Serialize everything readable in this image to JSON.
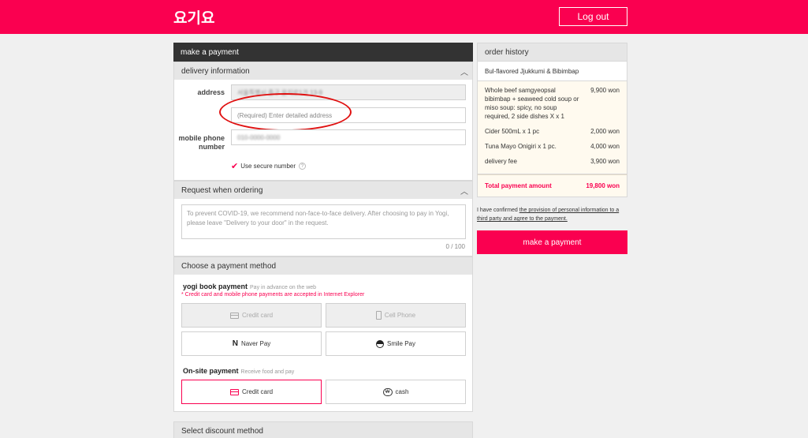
{
  "header": {
    "logo": "요기요",
    "logout_label": "Log out"
  },
  "payment": {
    "title": "make a payment",
    "delivery": {
      "heading": "delivery information",
      "address_label": "address",
      "address_value": "서울특별시 중구 을지로1가 13-9",
      "detail_placeholder": "(Required) Enter detailed address",
      "phone_label": "mobile phone number",
      "phone_value": "010-0000-0000",
      "secure_label": "Use secure number",
      "secure_help": "?"
    },
    "request": {
      "heading": "Request when ordering",
      "placeholder": "To prevent COVID-19, we recommend non-face-to-face delivery.  After choosing to pay in Yogi, please leave \"Delivery to your door\" in the request.",
      "counter": "0 / 100"
    },
    "method": {
      "heading": "Choose a payment method",
      "yogi_title": "yogi book payment",
      "yogi_sub": "Pay in advance on the web",
      "yogi_note": "* Credit card and mobile phone payments are accepted in Internet Explorer",
      "credit_card": "Credit card",
      "cell_phone": "Cell Phone",
      "naver_pay": "Naver Pay",
      "smile_pay": "Smile Pay",
      "onsite_title": "On-site payment",
      "onsite_sub": "Receive food and pay",
      "onsite_credit": "Credit card",
      "cash": "cash",
      "naver_glyph": "N",
      "cash_glyph": "₩"
    },
    "discount_heading": "Select discount method"
  },
  "order_history": {
    "heading": "order history",
    "restaurant": "Bul-flavored Jjukkumi & Bibimbap",
    "items": [
      {
        "name": "Whole beef samgyeopsal bibimbap + seaweed cold soup or miso soup: spicy, no soup required, 2 side dishes X x 1",
        "price": "9,900 won"
      },
      {
        "name": "Cider 500mL x 1 pc",
        "price": "2,000 won"
      },
      {
        "name": "Tuna Mayo Onigiri x 1 pc.",
        "price": "4,000 won"
      },
      {
        "name": "delivery fee",
        "price": "3,900 won"
      }
    ],
    "total_label": "Total payment amount",
    "total_value": "19,800 won"
  },
  "confirm": {
    "prefix": "I have confirmed ",
    "link": "the provision of personal information to a third party and agree to the payment."
  },
  "make_payment_label": "make a payment",
  "colors": {
    "brand": "#fa0050",
    "dark_header": "#333333",
    "highlight_ellipse": "#e01010"
  }
}
